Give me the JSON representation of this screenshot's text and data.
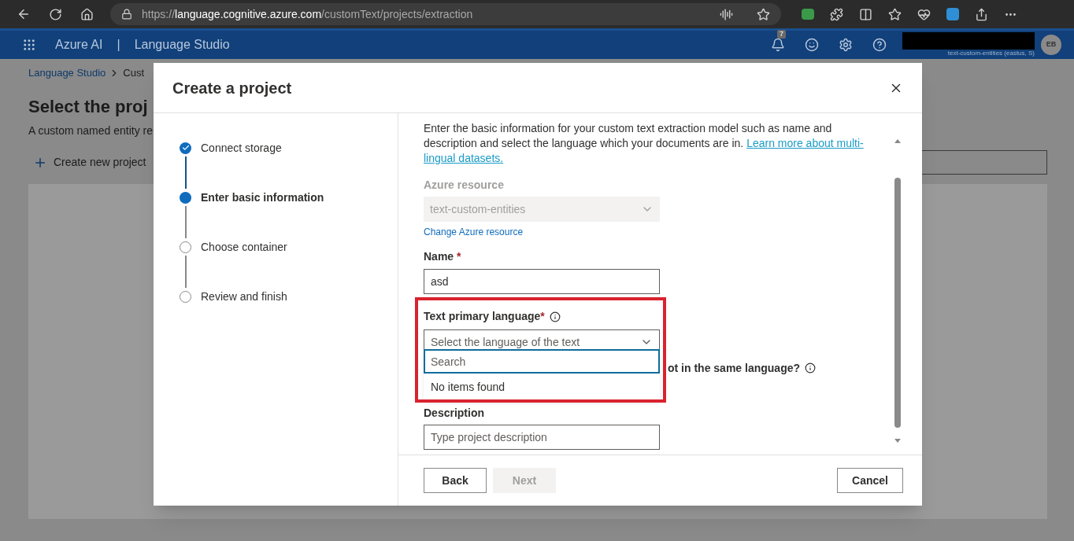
{
  "browser": {
    "scheme": "https://",
    "host": "language.cognitive.azure.com",
    "path": "/customText/projects/extraction"
  },
  "header": {
    "brand": "Azure AI",
    "separator": "|",
    "product": "Language Studio",
    "notifications": "7",
    "account": "text-custom-entities (eastus, S)",
    "avatar": "EB"
  },
  "page": {
    "breadcrumb": [
      "Language Studio",
      "Cust"
    ],
    "title": "Select the proj",
    "subtitle": "A custom named entity re",
    "create_button": "Create new project"
  },
  "dialog": {
    "title": "Create a project",
    "steps": [
      {
        "label": "Connect storage",
        "completed": true,
        "selected": false
      },
      {
        "label": "Enter basic information",
        "completed": false,
        "selected": true
      },
      {
        "label": "Choose container",
        "completed": false,
        "selected": false
      },
      {
        "label": "Review and finish",
        "completed": false,
        "selected": false
      }
    ],
    "intro": "Enter the basic information for your custom text extraction model such as name and description and select the language which your documents are in.",
    "intro_link_lines": [
      "Learn more about multi-",
      "lingual datasets."
    ],
    "azure_resource": {
      "label": "Azure resource",
      "value": "text-custom-entities",
      "disabled": true
    },
    "change_link": "Change Azure resource",
    "name": {
      "label": "Name",
      "required_mark": "*",
      "value": "asd"
    },
    "language": {
      "label": "Text primary language",
      "required_mark": "*",
      "placeholder": "Select the language of the text",
      "expanded": true,
      "search_placeholder": "Search",
      "empty_text": "No items found"
    },
    "partial_question": "ot in the same language?",
    "description": {
      "label": "Description",
      "placeholder": "Type project description"
    },
    "buttons": [
      {
        "label": "Back",
        "disabled": false
      },
      {
        "label": "Next",
        "disabled": true
      }
    ],
    "cancel": "Cancel"
  }
}
